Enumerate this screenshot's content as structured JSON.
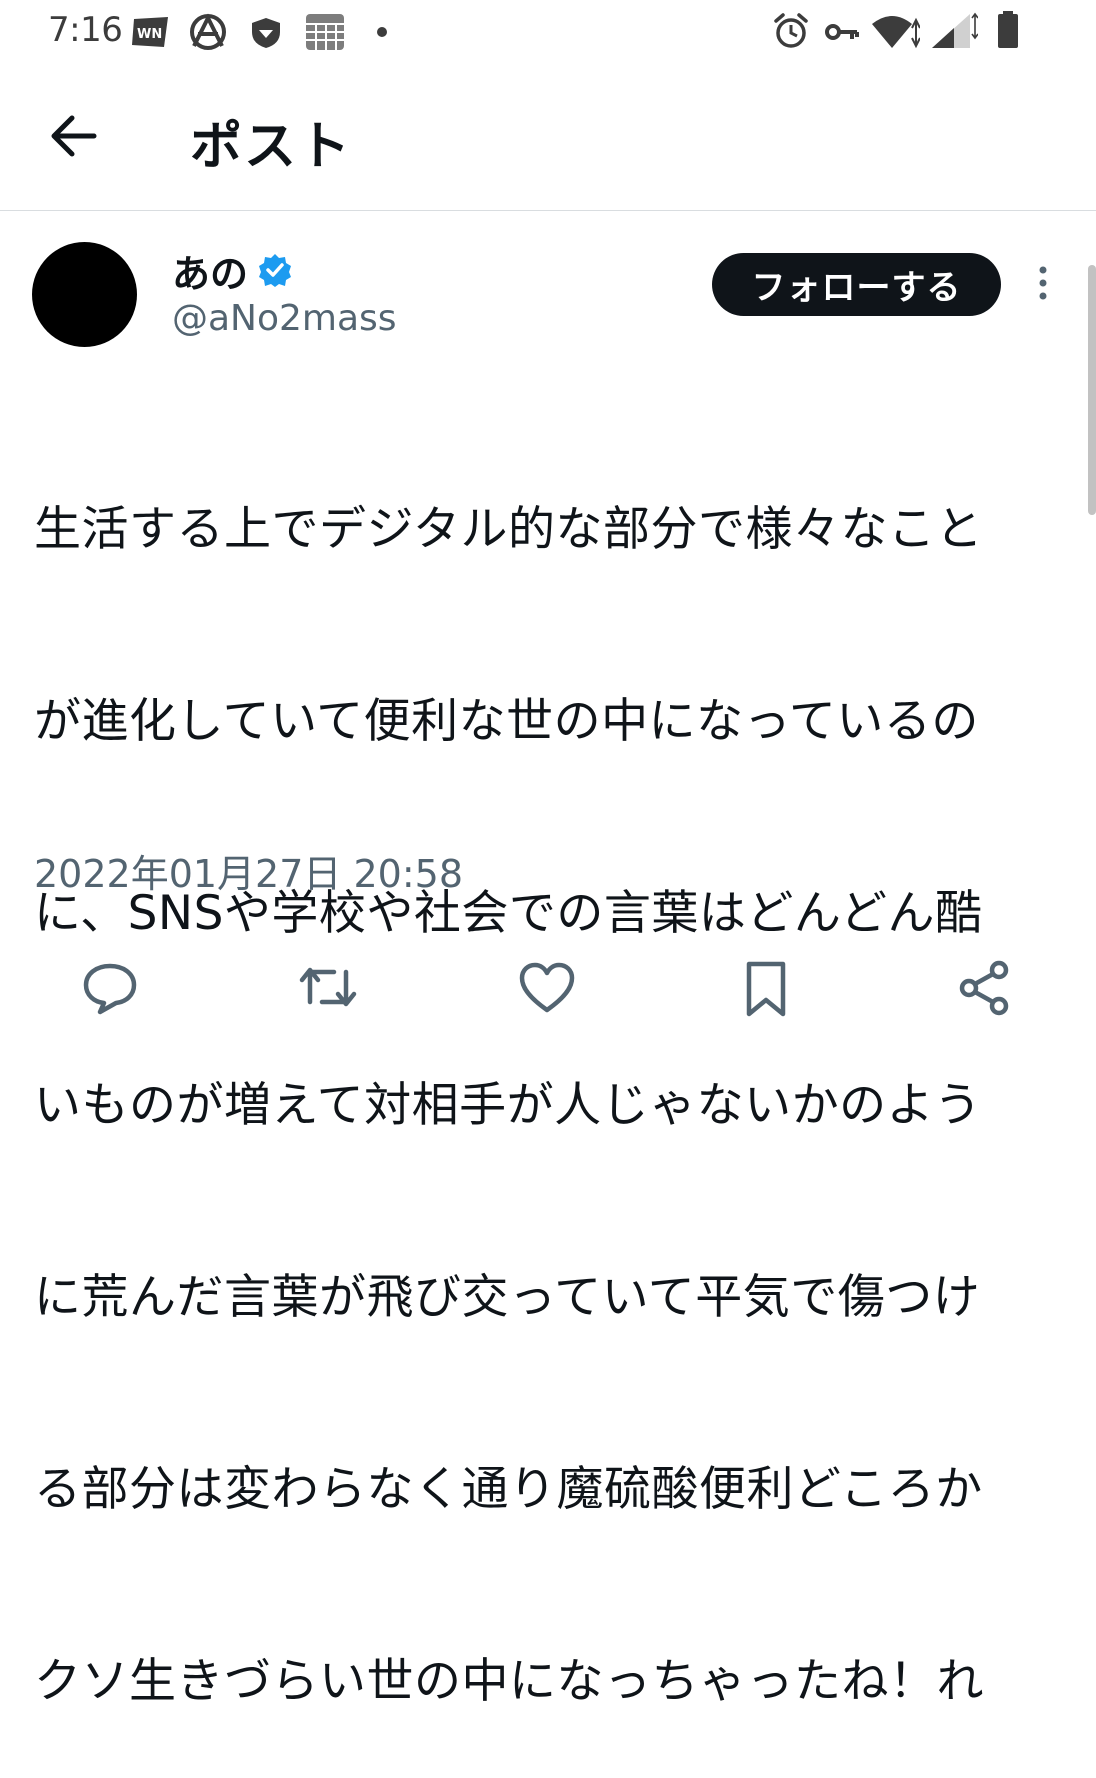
{
  "status_bar": {
    "time": "7:16",
    "left_icons": [
      "news-app-icon",
      "soccer-icon",
      "vpn-shield-icon",
      "calendar-grid-icon",
      "notification-dot-icon"
    ],
    "right_icons": [
      "alarm-icon",
      "key-icon",
      "wifi-icon",
      "signal-icon",
      "battery-icon"
    ]
  },
  "header": {
    "title": "ポスト",
    "back_icon": "arrow-left-icon"
  },
  "author": {
    "display_name": "あの",
    "handle": "@aNo2mass",
    "verified": true,
    "follow_label": "フォローする"
  },
  "post": {
    "lines": [
      "生活する上でデジタル的な部分で様々なこと",
      "が進化していて便利な世の中になっているの",
      "に、SNSや学校や社会での言葉はどんどん酷",
      "いものが増えて対相手が人じゃないかのよう",
      "に荒んだ言葉が飛び交っていて平気で傷つけ",
      "る部分は変わらなく通り魔硫酸便利どころか",
      "クソ生きづらい世の中になっちゃったね！れ"
    ],
    "timestamp": "2022年01月27日 20:58"
  },
  "actions": [
    "reply-icon",
    "retweet-icon",
    "like-icon",
    "bookmark-icon",
    "share-icon"
  ],
  "colors": {
    "text_primary": "#0f1419",
    "text_secondary": "#536471",
    "verified_blue": "#1d9bf0",
    "divider": "#d9dde0"
  }
}
